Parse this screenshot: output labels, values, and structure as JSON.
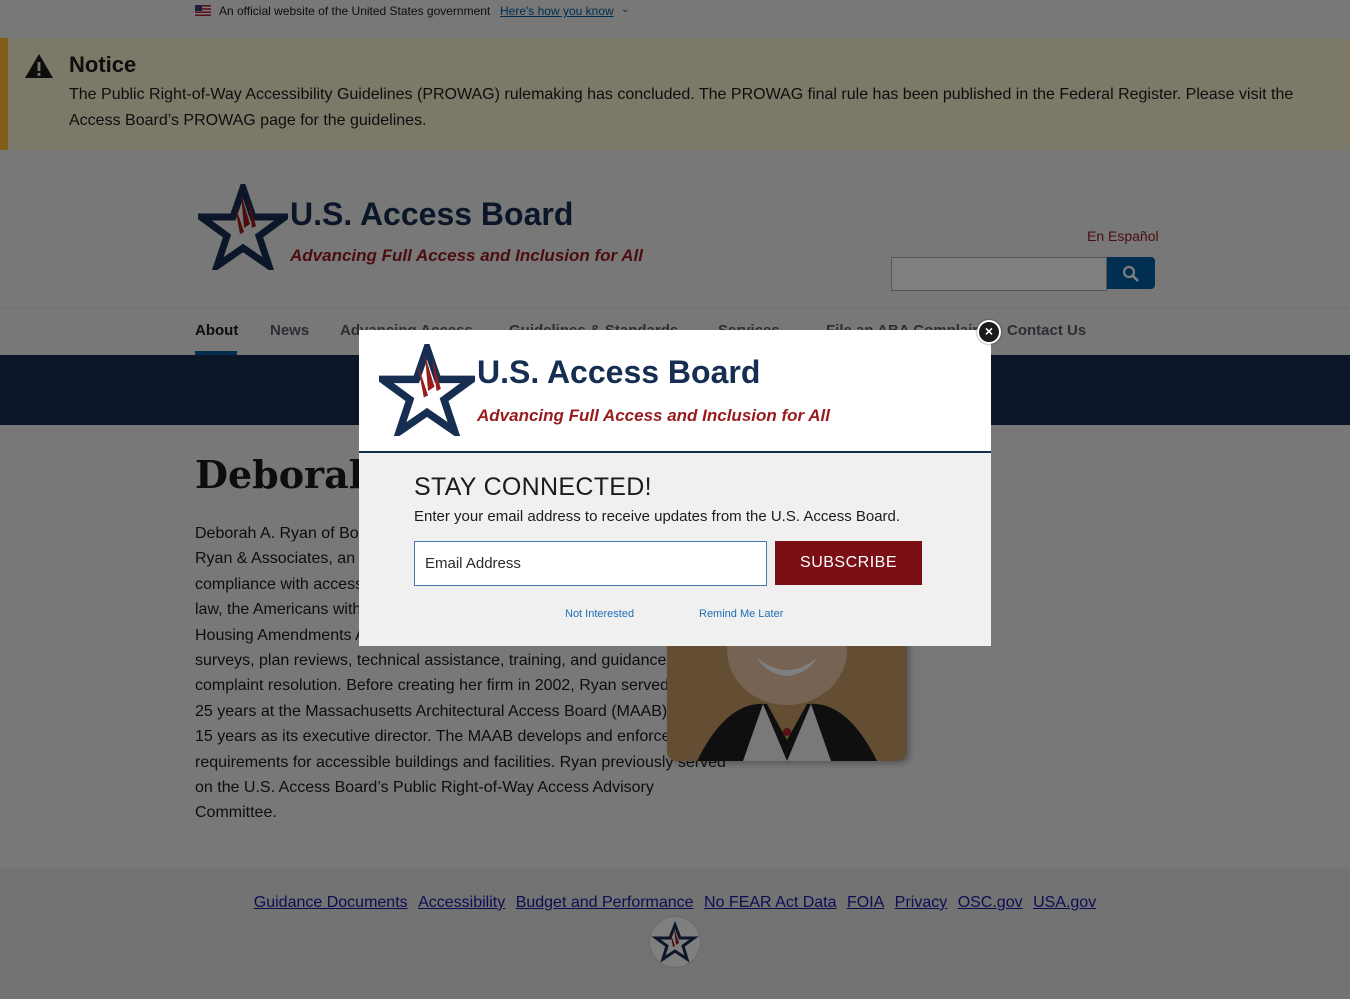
{
  "gov_banner": {
    "text": "An official website of the United States government",
    "link": "Here's how you know"
  },
  "notice": {
    "title": "Notice",
    "body": "The Public Right-of-Way Accessibility Guidelines (PROWAG) rulemaking has concluded. The PROWAG final rule has been published in the Federal Register. Please visit the Access Board’s PROWAG page for the guidelines."
  },
  "header": {
    "title": "U.S. Access Board",
    "tagline": "Advancing Full Access and Inclusion for All",
    "language_link": "En Español",
    "search_placeholder": ""
  },
  "nav": {
    "items": [
      {
        "label": "About"
      },
      {
        "label": "News"
      },
      {
        "label": "Advancing Access"
      },
      {
        "label": "Guidelines & Standards"
      },
      {
        "label": "Services"
      },
      {
        "label": "File an ABA Complaint"
      },
      {
        "label": "Contact Us"
      }
    ]
  },
  "content": {
    "title": "Deborah A. Ryan",
    "bio": "Deborah A. Ryan of Boston, Massachusetts, is the president of Deborah A. Ryan & Associates, an accessibility consulting firm. Her firm specializes in compliance with accessibility codes and standards under Massachusetts law, the Americans with Disabilities Act, the Rehabilitation Act, and the Fair Housing Amendments Act. In this capacity, she is active in accessibility surveys, plan reviews, technical assistance, training, and guidance on complaint resolution. Before creating her firm in 2002, Ryan served for over 25 years at the Massachusetts Architectural Access Board (MAAB), including 15 years as its executive director. The MAAB develops and enforces state requirements for accessible buildings and facilities. Ryan previously served on the U.S. Access Board’s Public Right-of-Way Access Advisory Committee."
  },
  "footer": {
    "links": [
      {
        "label": "Guidance Documents"
      },
      {
        "label": "Accessibility"
      },
      {
        "label": "Budget and Performance"
      },
      {
        "label": "No FEAR Act Data"
      },
      {
        "label": "FOIA"
      },
      {
        "label": "Privacy"
      },
      {
        "label": "OSC.gov"
      },
      {
        "label": "USA.gov"
      }
    ]
  },
  "modal": {
    "title": "U.S. Access Board",
    "tagline": "Advancing Full Access and Inclusion for All",
    "heading": "STAY CONNECTED!",
    "subtext": "Enter your email address to receive updates from the U.S. Access Board.",
    "email_placeholder": "Email Address",
    "subscribe_label": "SUBSCRIBE",
    "not_interested": "Not Interested",
    "remind_later": "Remind Me Later",
    "close_glyph": "×"
  },
  "colors": {
    "navy": "#162e51",
    "brand_red": "#981b1e",
    "subscribe_red": "#7a0f15",
    "notice_bg": "#faf3d1",
    "notice_border": "#ffbe2e",
    "link_blue": "#005ea2"
  }
}
